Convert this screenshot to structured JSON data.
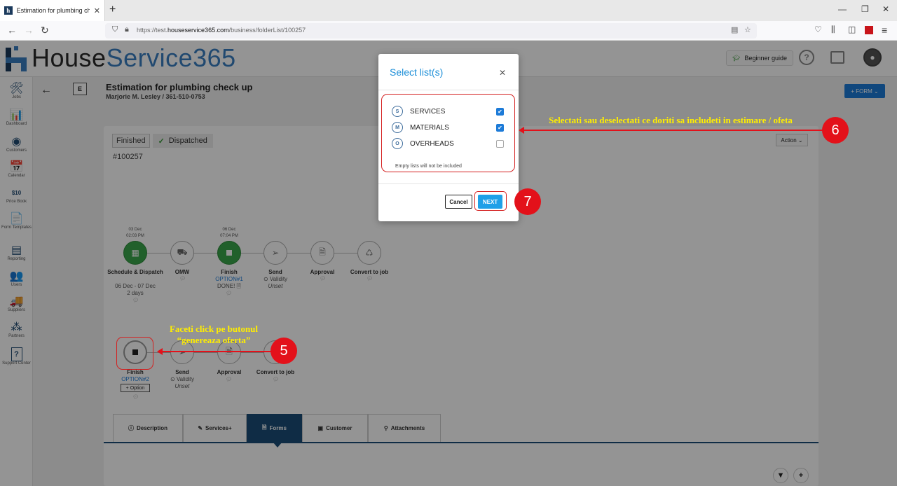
{
  "browser": {
    "tab_title": "Estimation for plumbing check",
    "url_prefix": "https://test.",
    "url_domain": "houseservice365.com",
    "url_path": "/business/folderList/100257"
  },
  "app": {
    "logo_part1": "House",
    "logo_part2": "Service365",
    "beginner_guide": "Beginner guide",
    "help_glyph": "?"
  },
  "sidebar": {
    "items": [
      {
        "label": "Jobs",
        "icon": "🛠"
      },
      {
        "label": "Dashboard",
        "icon": "📊"
      },
      {
        "label": "Customers",
        "icon": "◉"
      },
      {
        "label": "Calendar",
        "icon": "📅"
      },
      {
        "label": "Price Book",
        "icon": "$10"
      },
      {
        "label": "Form Templates",
        "icon": "📄"
      },
      {
        "label": "Reporting",
        "icon": "▤"
      },
      {
        "label": "Users",
        "icon": "👥"
      },
      {
        "label": "Suppliers",
        "icon": "🚚"
      },
      {
        "label": "Partners",
        "icon": "⁂"
      },
      {
        "label": "Support Center",
        "icon": "?"
      }
    ]
  },
  "header": {
    "badge": "E",
    "title": "Estimation for plumbing check up",
    "subtitle": "Marjorie M. Lesley / 361-510-0753",
    "form_button": "+ FORM ⌄"
  },
  "job": {
    "status_finished": "Finished",
    "status_dispatched": "Dispatched",
    "job_number": "#100257",
    "action_button": "Action ⌄"
  },
  "workflow1": {
    "steps": [
      {
        "date1": "03 Dec",
        "date2": "02:03 PM",
        "label": "Schedule & Dispatch",
        "sub1": "06 Dec - 07 Dec",
        "sub2": "2 days"
      },
      {
        "label": "OMW"
      },
      {
        "date1": "06 Dec",
        "date2": "07:04 PM",
        "label": "Finish",
        "sub1": "OPTION#1",
        "sub2": "DONE! 🗎"
      },
      {
        "label": "Send",
        "sub1": "⊙ Validity",
        "sub2": "Unset"
      },
      {
        "label": "Approval"
      },
      {
        "label": "Convert to job"
      }
    ]
  },
  "workflow2": {
    "steps": [
      {
        "label": "Finish",
        "sub1": "OPTION#2",
        "option_button": "+ Option"
      },
      {
        "label": "Send",
        "sub1": "⊙ Validity",
        "sub2": "Unset"
      },
      {
        "label": "Approval"
      },
      {
        "label": "Convert to job"
      }
    ]
  },
  "tabs": [
    {
      "label": "Description",
      "icon": "ⓘ"
    },
    {
      "label": "Services+",
      "icon": "✎"
    },
    {
      "label": "Forms",
      "icon": "🗎"
    },
    {
      "label": "Customer",
      "icon": "▣"
    },
    {
      "label": "Attachments",
      "icon": "⚲"
    }
  ],
  "modal": {
    "title": "Select list(s)",
    "items": [
      {
        "badge": "S",
        "label": "SERVICES",
        "checked": true
      },
      {
        "badge": "M",
        "label": "MATERIALS",
        "checked": true
      },
      {
        "badge": "O",
        "label": "OVERHEADS",
        "checked": false
      }
    ],
    "note": "Empty lists will not be included",
    "cancel": "Cancel",
    "next": "NEXT"
  },
  "annotations": {
    "text6": "Selectati sau deselectati ce doriti sa includeti in estimare / ofeta",
    "text5_line1": "Faceti click pe butonul",
    "text5_line2": "“genereaza oferta”",
    "n5": "5",
    "n6": "6",
    "n7": "7"
  },
  "colors": {
    "accent": "#1d7bd8",
    "annotation_red": "#e3111a",
    "annotation_text": "#ffee00",
    "done_green": "#3aa54a"
  }
}
